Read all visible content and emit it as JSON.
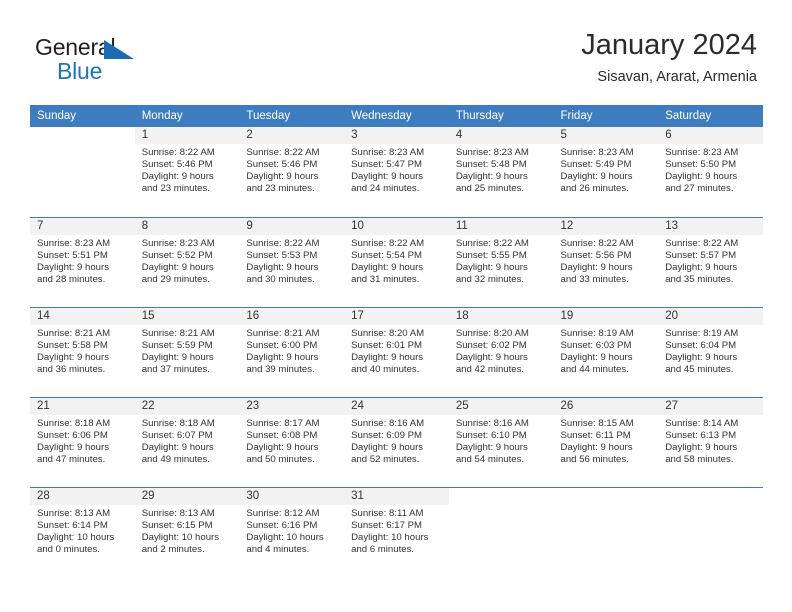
{
  "logo": {
    "word1": "General",
    "word2": "Blue",
    "accent_color": "#1b75bb"
  },
  "header": {
    "month_title": "January 2024",
    "location": "Sisavan, Ararat, Armenia",
    "header_bg": "#3d7cbf"
  },
  "weekday_headers": [
    "Sunday",
    "Monday",
    "Tuesday",
    "Wednesday",
    "Thursday",
    "Friday",
    "Saturday"
  ],
  "weeks": [
    [
      {
        "day": "",
        "sunrise": "",
        "sunset": "",
        "daylight_line1": "",
        "daylight_line2": ""
      },
      {
        "day": "1",
        "sunrise": "Sunrise: 8:22 AM",
        "sunset": "Sunset: 5:46 PM",
        "daylight_line1": "Daylight: 9 hours",
        "daylight_line2": "and 23 minutes."
      },
      {
        "day": "2",
        "sunrise": "Sunrise: 8:22 AM",
        "sunset": "Sunset: 5:46 PM",
        "daylight_line1": "Daylight: 9 hours",
        "daylight_line2": "and 23 minutes."
      },
      {
        "day": "3",
        "sunrise": "Sunrise: 8:23 AM",
        "sunset": "Sunset: 5:47 PM",
        "daylight_line1": "Daylight: 9 hours",
        "daylight_line2": "and 24 minutes."
      },
      {
        "day": "4",
        "sunrise": "Sunrise: 8:23 AM",
        "sunset": "Sunset: 5:48 PM",
        "daylight_line1": "Daylight: 9 hours",
        "daylight_line2": "and 25 minutes."
      },
      {
        "day": "5",
        "sunrise": "Sunrise: 8:23 AM",
        "sunset": "Sunset: 5:49 PM",
        "daylight_line1": "Daylight: 9 hours",
        "daylight_line2": "and 26 minutes."
      },
      {
        "day": "6",
        "sunrise": "Sunrise: 8:23 AM",
        "sunset": "Sunset: 5:50 PM",
        "daylight_line1": "Daylight: 9 hours",
        "daylight_line2": "and 27 minutes."
      }
    ],
    [
      {
        "day": "7",
        "sunrise": "Sunrise: 8:23 AM",
        "sunset": "Sunset: 5:51 PM",
        "daylight_line1": "Daylight: 9 hours",
        "daylight_line2": "and 28 minutes."
      },
      {
        "day": "8",
        "sunrise": "Sunrise: 8:23 AM",
        "sunset": "Sunset: 5:52 PM",
        "daylight_line1": "Daylight: 9 hours",
        "daylight_line2": "and 29 minutes."
      },
      {
        "day": "9",
        "sunrise": "Sunrise: 8:22 AM",
        "sunset": "Sunset: 5:53 PM",
        "daylight_line1": "Daylight: 9 hours",
        "daylight_line2": "and 30 minutes."
      },
      {
        "day": "10",
        "sunrise": "Sunrise: 8:22 AM",
        "sunset": "Sunset: 5:54 PM",
        "daylight_line1": "Daylight: 9 hours",
        "daylight_line2": "and 31 minutes."
      },
      {
        "day": "11",
        "sunrise": "Sunrise: 8:22 AM",
        "sunset": "Sunset: 5:55 PM",
        "daylight_line1": "Daylight: 9 hours",
        "daylight_line2": "and 32 minutes."
      },
      {
        "day": "12",
        "sunrise": "Sunrise: 8:22 AM",
        "sunset": "Sunset: 5:56 PM",
        "daylight_line1": "Daylight: 9 hours",
        "daylight_line2": "and 33 minutes."
      },
      {
        "day": "13",
        "sunrise": "Sunrise: 8:22 AM",
        "sunset": "Sunset: 5:57 PM",
        "daylight_line1": "Daylight: 9 hours",
        "daylight_line2": "and 35 minutes."
      }
    ],
    [
      {
        "day": "14",
        "sunrise": "Sunrise: 8:21 AM",
        "sunset": "Sunset: 5:58 PM",
        "daylight_line1": "Daylight: 9 hours",
        "daylight_line2": "and 36 minutes."
      },
      {
        "day": "15",
        "sunrise": "Sunrise: 8:21 AM",
        "sunset": "Sunset: 5:59 PM",
        "daylight_line1": "Daylight: 9 hours",
        "daylight_line2": "and 37 minutes."
      },
      {
        "day": "16",
        "sunrise": "Sunrise: 8:21 AM",
        "sunset": "Sunset: 6:00 PM",
        "daylight_line1": "Daylight: 9 hours",
        "daylight_line2": "and 39 minutes."
      },
      {
        "day": "17",
        "sunrise": "Sunrise: 8:20 AM",
        "sunset": "Sunset: 6:01 PM",
        "daylight_line1": "Daylight: 9 hours",
        "daylight_line2": "and 40 minutes."
      },
      {
        "day": "18",
        "sunrise": "Sunrise: 8:20 AM",
        "sunset": "Sunset: 6:02 PM",
        "daylight_line1": "Daylight: 9 hours",
        "daylight_line2": "and 42 minutes."
      },
      {
        "day": "19",
        "sunrise": "Sunrise: 8:19 AM",
        "sunset": "Sunset: 6:03 PM",
        "daylight_line1": "Daylight: 9 hours",
        "daylight_line2": "and 44 minutes."
      },
      {
        "day": "20",
        "sunrise": "Sunrise: 8:19 AM",
        "sunset": "Sunset: 6:04 PM",
        "daylight_line1": "Daylight: 9 hours",
        "daylight_line2": "and 45 minutes."
      }
    ],
    [
      {
        "day": "21",
        "sunrise": "Sunrise: 8:18 AM",
        "sunset": "Sunset: 6:06 PM",
        "daylight_line1": "Daylight: 9 hours",
        "daylight_line2": "and 47 minutes."
      },
      {
        "day": "22",
        "sunrise": "Sunrise: 8:18 AM",
        "sunset": "Sunset: 6:07 PM",
        "daylight_line1": "Daylight: 9 hours",
        "daylight_line2": "and 49 minutes."
      },
      {
        "day": "23",
        "sunrise": "Sunrise: 8:17 AM",
        "sunset": "Sunset: 6:08 PM",
        "daylight_line1": "Daylight: 9 hours",
        "daylight_line2": "and 50 minutes."
      },
      {
        "day": "24",
        "sunrise": "Sunrise: 8:16 AM",
        "sunset": "Sunset: 6:09 PM",
        "daylight_line1": "Daylight: 9 hours",
        "daylight_line2": "and 52 minutes."
      },
      {
        "day": "25",
        "sunrise": "Sunrise: 8:16 AM",
        "sunset": "Sunset: 6:10 PM",
        "daylight_line1": "Daylight: 9 hours",
        "daylight_line2": "and 54 minutes."
      },
      {
        "day": "26",
        "sunrise": "Sunrise: 8:15 AM",
        "sunset": "Sunset: 6:11 PM",
        "daylight_line1": "Daylight: 9 hours",
        "daylight_line2": "and 56 minutes."
      },
      {
        "day": "27",
        "sunrise": "Sunrise: 8:14 AM",
        "sunset": "Sunset: 6:13 PM",
        "daylight_line1": "Daylight: 9 hours",
        "daylight_line2": "and 58 minutes."
      }
    ],
    [
      {
        "day": "28",
        "sunrise": "Sunrise: 8:13 AM",
        "sunset": "Sunset: 6:14 PM",
        "daylight_line1": "Daylight: 10 hours",
        "daylight_line2": "and 0 minutes."
      },
      {
        "day": "29",
        "sunrise": "Sunrise: 8:13 AM",
        "sunset": "Sunset: 6:15 PM",
        "daylight_line1": "Daylight: 10 hours",
        "daylight_line2": "and 2 minutes."
      },
      {
        "day": "30",
        "sunrise": "Sunrise: 8:12 AM",
        "sunset": "Sunset: 6:16 PM",
        "daylight_line1": "Daylight: 10 hours",
        "daylight_line2": "and 4 minutes."
      },
      {
        "day": "31",
        "sunrise": "Sunrise: 8:11 AM",
        "sunset": "Sunset: 6:17 PM",
        "daylight_line1": "Daylight: 10 hours",
        "daylight_line2": "and 6 minutes."
      },
      {
        "day": "",
        "sunrise": "",
        "sunset": "",
        "daylight_line1": "",
        "daylight_line2": ""
      },
      {
        "day": "",
        "sunrise": "",
        "sunset": "",
        "daylight_line1": "",
        "daylight_line2": ""
      },
      {
        "day": "",
        "sunrise": "",
        "sunset": "",
        "daylight_line1": "",
        "daylight_line2": ""
      }
    ]
  ]
}
